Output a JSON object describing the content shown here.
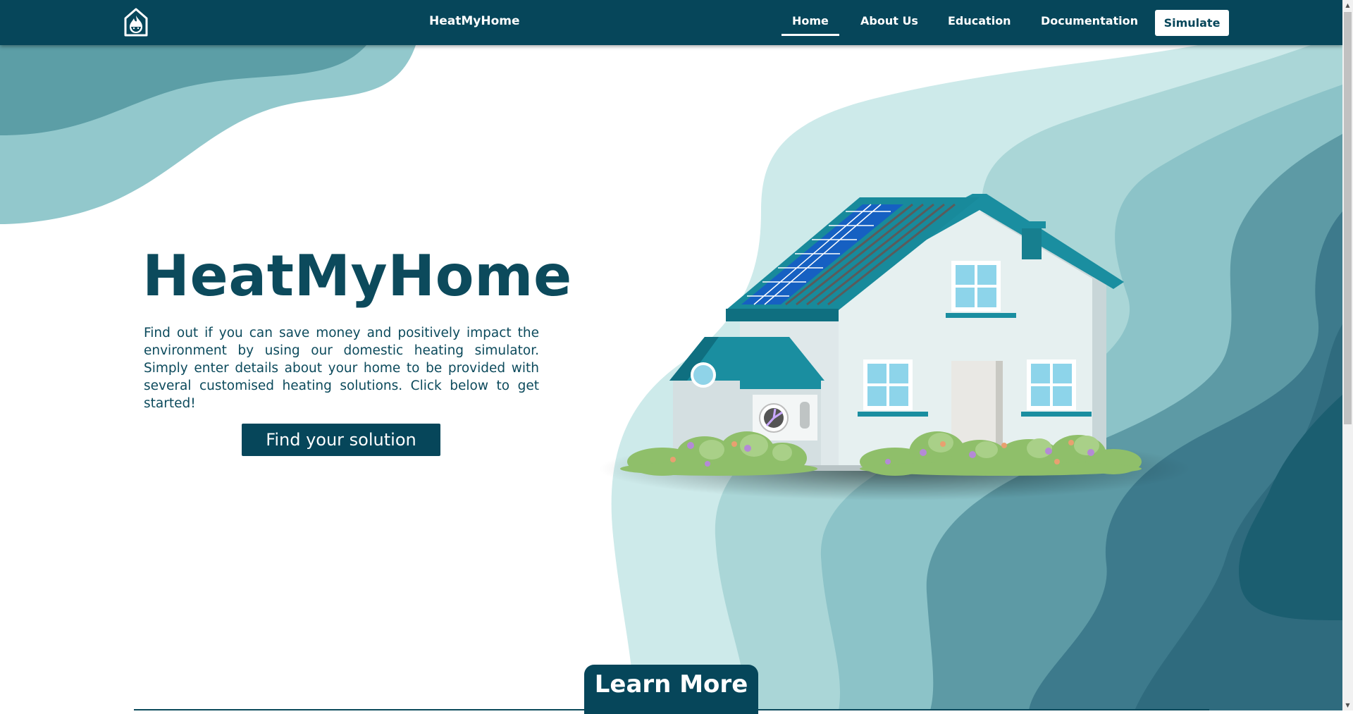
{
  "colors": {
    "primary": "#06465a",
    "title_text": "#0c4a5c",
    "background": "#ffffff",
    "wave_light": "#cdeaea",
    "wave_mid": "#8fc7cc",
    "wave_dark": "#1b5e70"
  },
  "navbar": {
    "logo_icon": "house-flame-icon",
    "brand": "HeatMyHome",
    "links": [
      {
        "label": "Home",
        "active": true
      },
      {
        "label": "About Us",
        "active": false
      },
      {
        "label": "Education",
        "active": false
      },
      {
        "label": "Documentation",
        "active": false
      }
    ],
    "simulate_label": "Simulate"
  },
  "hero": {
    "title": "HeatMyHome",
    "description": "Find out if you can save money and positively impact the environment by using our domestic heating simulator. Simply enter details about your home to be provided with several customised heating solutions. Click below to get started!",
    "cta_label": "Find your solution",
    "illustration_icon": "house-with-solar-panels-illustration"
  },
  "footer_tab": {
    "learn_more_label": "Learn More"
  }
}
